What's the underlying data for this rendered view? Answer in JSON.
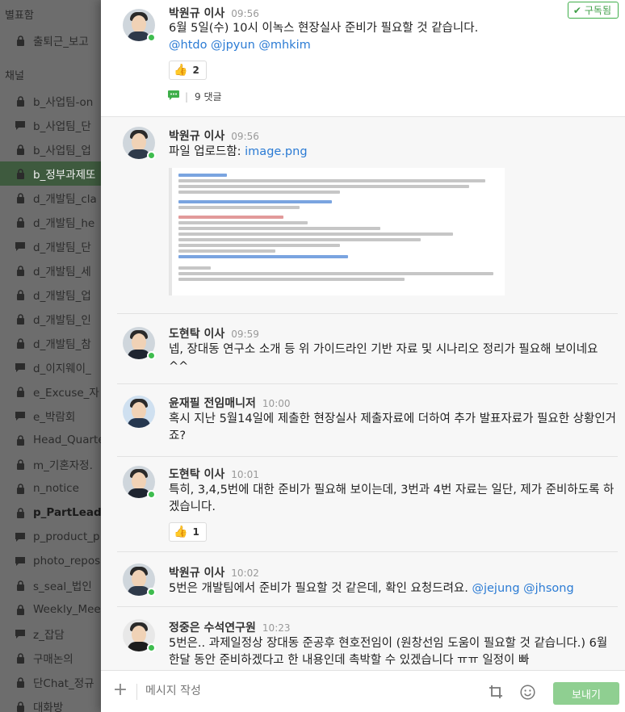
{
  "sidebar": {
    "section_favorites": "별표함",
    "section_channels": "채널",
    "favorites": [
      {
        "label": "출퇴근_보고",
        "icon": "lock-icon"
      }
    ],
    "channels": [
      {
        "label": "b_사업팀-on",
        "icon": "lock-icon"
      },
      {
        "label": "b_사업팀_단",
        "icon": "chat-bubble-icon"
      },
      {
        "label": "b_사업팀_업",
        "icon": "lock-icon"
      },
      {
        "label": "b_정부과제또",
        "icon": "lock-icon"
      },
      {
        "label": "d_개발팀_cla",
        "icon": "lock-icon"
      },
      {
        "label": "d_개발팀_he",
        "icon": "lock-icon"
      },
      {
        "label": "d_개발팀_단",
        "icon": "chat-bubble-icon"
      },
      {
        "label": "d_개발팀_세",
        "icon": "lock-icon"
      },
      {
        "label": "d_개발팀_업",
        "icon": "lock-icon"
      },
      {
        "label": "d_개발팀_인",
        "icon": "lock-icon"
      },
      {
        "label": "d_개발팀_참",
        "icon": "lock-icon"
      },
      {
        "label": "d_이지웨이_",
        "icon": "chat-bubble-icon"
      },
      {
        "label": "e_Excuse_자",
        "icon": "lock-icon"
      },
      {
        "label": "e_박람회",
        "icon": "chat-bubble-icon"
      },
      {
        "label": "Head_Quarte",
        "icon": "lock-icon"
      },
      {
        "label": "m_기혼자정.",
        "icon": "lock-icon"
      },
      {
        "label": "n_notice",
        "icon": "lock-icon"
      },
      {
        "label": "p_PartLeade",
        "icon": "lock-icon"
      },
      {
        "label": "p_product_p",
        "icon": "chat-bubble-icon"
      },
      {
        "label": "photo_repos",
        "icon": "chat-bubble-icon"
      },
      {
        "label": "s_seal_법인",
        "icon": "lock-icon"
      },
      {
        "label": "Weekly_Mee",
        "icon": "lock-icon"
      },
      {
        "label": "z_잡담",
        "icon": "chat-bubble-icon"
      },
      {
        "label": "구매논의",
        "icon": "lock-icon"
      },
      {
        "label": "단Chat_정규",
        "icon": "lock-icon"
      },
      {
        "label": "대화방",
        "icon": "lock-icon"
      }
    ]
  },
  "thread": {
    "parent": {
      "author": "박원규 이사",
      "time": "09:56",
      "text": "6월 5일(수) 10시 이녹스 현장실사 준비가 필요할 것 같습니다.",
      "mentions": "@htdo @jpyun @mhkim",
      "reaction_count": "2",
      "comment_count": "9 댓글",
      "subscribed_label": "구독됨"
    },
    "replies": [
      {
        "author": "박원규 이사",
        "time": "09:56",
        "text": "파일 업로드함:",
        "link": "image.png"
      },
      {
        "author": "도현탁 이사",
        "time": "09:59",
        "text": "넵, 장대동 연구소 소개 등 위 가이드라인 기반 자료 및 시나리오 정리가 필요해 보이네요^^"
      },
      {
        "author": "윤재필 전임매니저",
        "time": "10:00",
        "text": "혹시 지난 5월14일에 제출한 현장실사 제출자료에 더하여 추가 발표자료가 필요한 상황인거죠?"
      },
      {
        "author": "도현탁 이사",
        "time": "10:01",
        "text": "특히, 3,4,5번에 대한 준비가 필요해 보이는데, 3번과 4번 자료는 일단, 제가 준비하도록 하겠습니다.",
        "reaction_count": "1"
      },
      {
        "author": "박원규 이사",
        "time": "10:02",
        "text": "5번은 개발팀에서 준비가 필요할 것 같은데, 확인 요청드려요.",
        "mentions": "@jejung @jhsong"
      },
      {
        "author": "정중은 수석연구원",
        "time": "10:23",
        "text": "5번은.. 과제일정상 장대동 준공후 현호전임이 (원창선임 도움이 필요할 것 같습니다.) 6월 한달 동안 준비하겠다고 한 내용인데 촉박할 수 있겠습니다 ㅠㅠ 일정이 빠"
      }
    ]
  },
  "composer": {
    "placeholder": "메시지 작성",
    "send_label": "보내기"
  },
  "colors": {
    "accent_green": "#3fae4a",
    "mention_blue": "#2b7bd4",
    "send_button": "#8fcf91"
  }
}
